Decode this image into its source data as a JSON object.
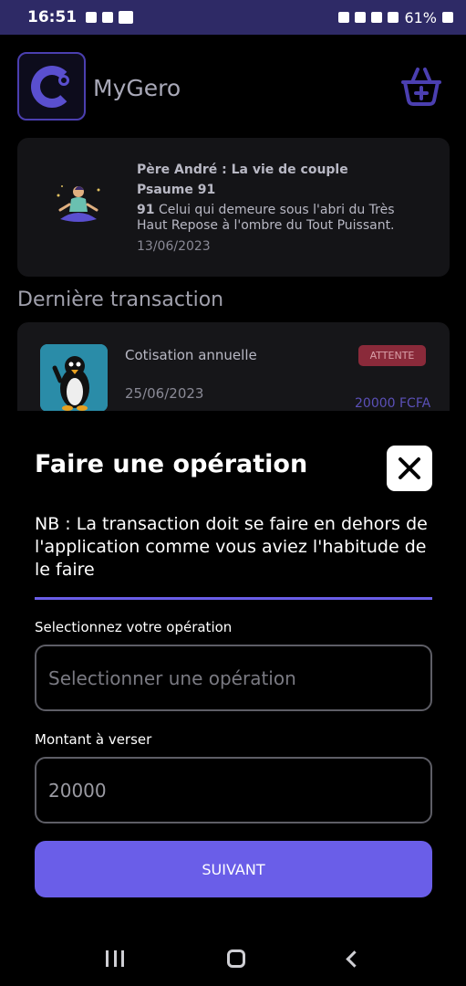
{
  "status_bar": {
    "time": "16:51",
    "battery": "61%",
    "icons": [
      "telegram-icon",
      "gallery-icon",
      "youtube-icon",
      "lock-icon",
      "mute-icon",
      "wifi-icon",
      "signal-icon",
      "battery-icon"
    ]
  },
  "header": {
    "app_name": "MyGero",
    "cart_icon": "cart-plus-icon"
  },
  "quote_card": {
    "title": "Père André : La vie de couple",
    "psalm": "Psaume 91",
    "verse_number": "91",
    "verse_text": "Celui qui demeure sous l'abri du Très Haut Repose à l'ombre du Tout Puissant.",
    "date": "13/06/2023"
  },
  "last_transaction": {
    "section_title": "Dernière transaction",
    "name": "Cotisation annuelle",
    "date": "25/06/2023",
    "status": "ATTENTE",
    "amount": "20000 FCFA"
  },
  "sheet": {
    "title": "Faire une opération",
    "note": "NB : La transaction doit se faire en dehors de l'application comme vous aviez l'habitude de le faire",
    "operation_label": "Selectionnez votre opération",
    "operation_placeholder": "Selectionner une opération",
    "amount_label": "Montant à verser",
    "amount_value": "20000",
    "next_label": "SUIVANT"
  },
  "colors": {
    "accent": "#6a5ee8",
    "status_bar": "#2e2a66",
    "badge": "#8a2a3a"
  }
}
